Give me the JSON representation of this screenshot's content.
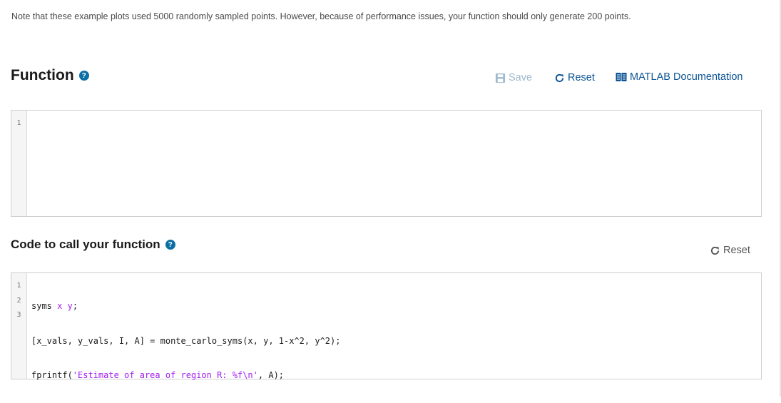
{
  "note": "Note that these example plots used 5000 randomly sampled points. However, because of performance issues, your function should only generate 200 points.",
  "function_section": {
    "title": "Function",
    "help_icon": "question-circle-icon",
    "save_label": "Save",
    "reset_label": "Reset",
    "doc_label": "MATLAB Documentation",
    "editor": {
      "line_numbers": [
        "1"
      ],
      "lines": [
        ""
      ]
    }
  },
  "call_section": {
    "title": "Code to call your function",
    "help_icon": "question-circle-icon",
    "reset_label": "Reset",
    "editor": {
      "line_numbers": [
        "1",
        "2",
        "3"
      ],
      "lines": [
        "syms x y;",
        "[x_vals, y_vals, I, A] = monte_carlo_syms(x, y, 1-x^2, y^2);",
        "fprintf('Estimate of area of region R: %f\\n', A);"
      ]
    }
  },
  "colors": {
    "link": "#0b5394",
    "disabled": "#9fb9cf",
    "help": "#0b6fa4",
    "keyword": "#a020f0"
  }
}
